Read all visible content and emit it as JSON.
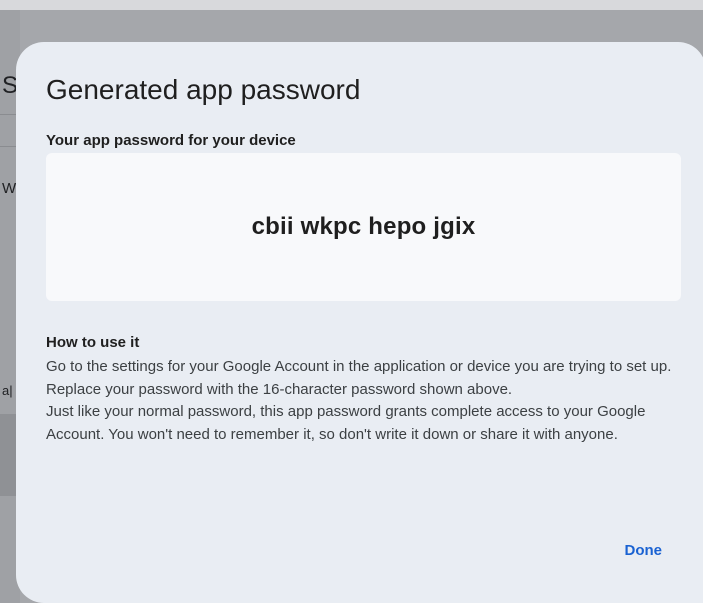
{
  "background": {
    "fragments": [
      "S",
      "W",
      "a|"
    ]
  },
  "dialog": {
    "title": "Generated app password",
    "subtitle": "Your app password for your device",
    "password": "cbii wkpc hepo jgix",
    "howto": {
      "heading": "How to use it",
      "paragraph1": "Go to the settings for your Google Account in the application or device you are trying to set up. Replace your password with the 16-character password shown above.",
      "paragraph2": "Just like your normal password, this app password grants complete access to your Google Account. You won't need to remember it, so don't write it down or share it with anyone."
    },
    "done_label": "Done"
  },
  "colors": {
    "dialog_bg": "#e9edf3",
    "password_box_bg": "#f8f9fb",
    "accent": "#1a62d2",
    "scrim": "#a5a7ab"
  }
}
